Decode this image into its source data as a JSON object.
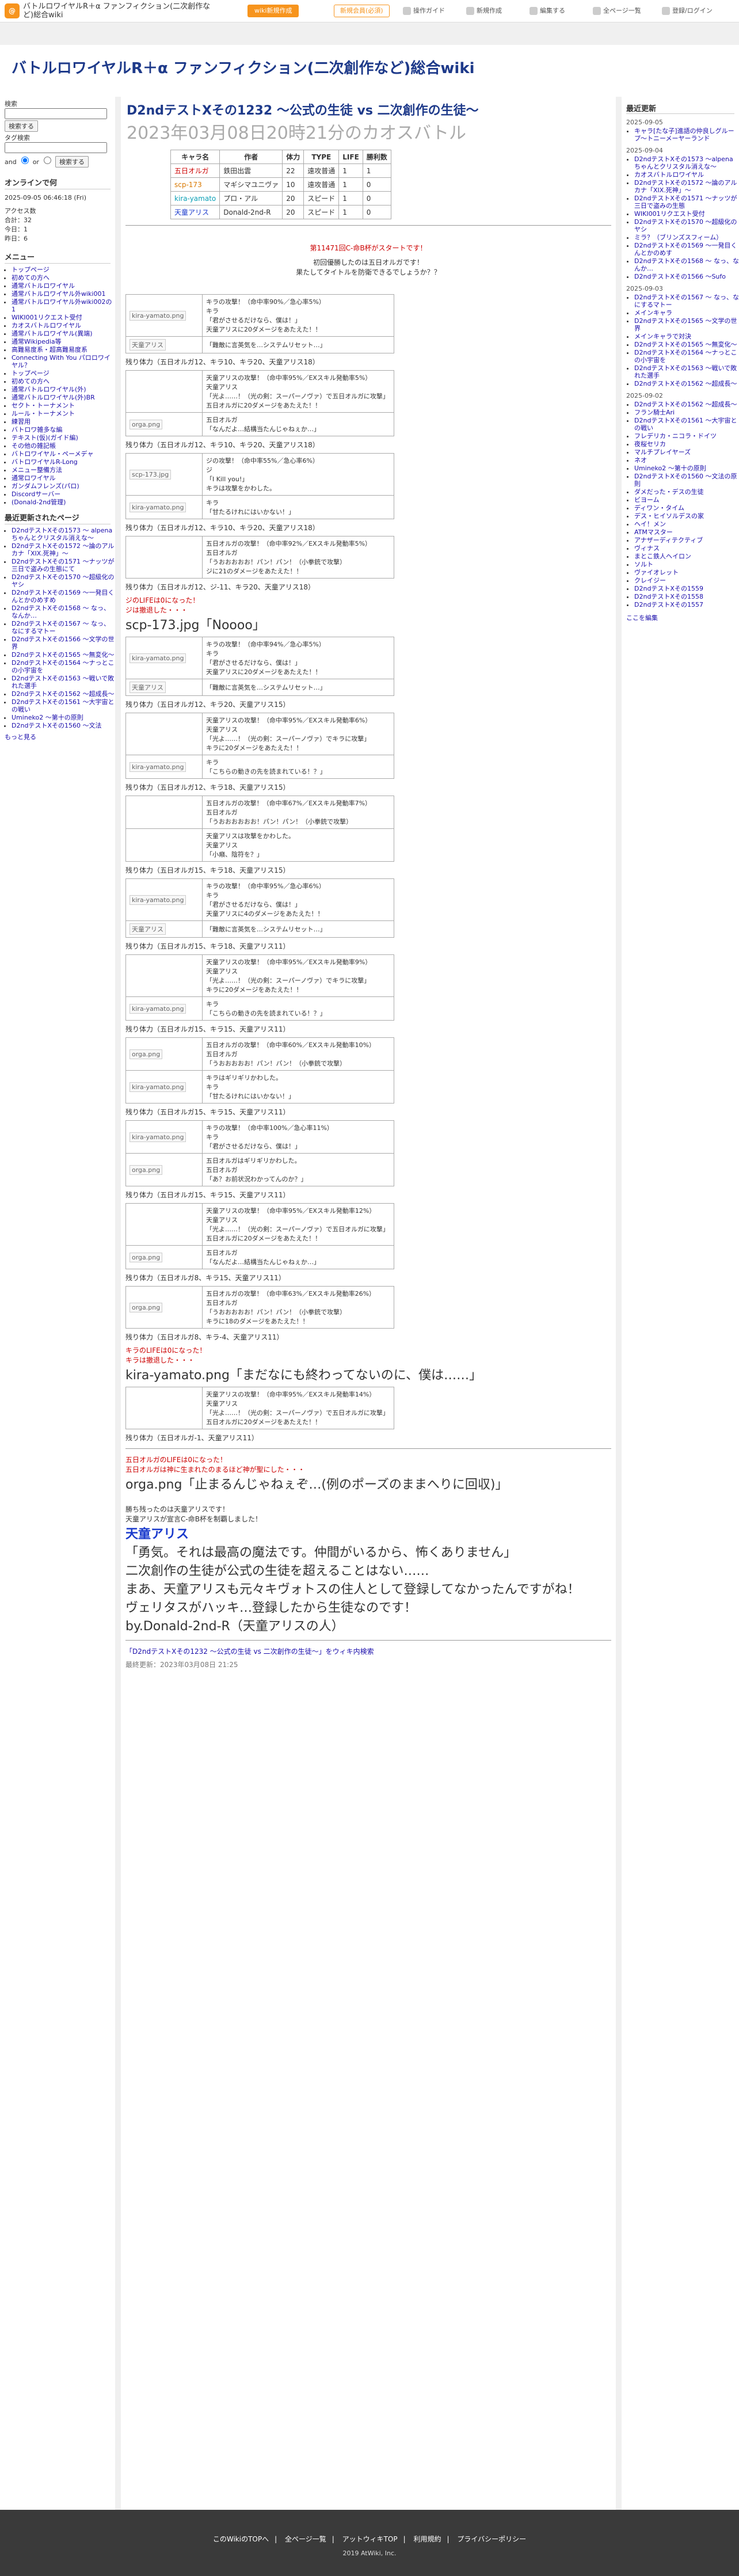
{
  "site": {
    "logo": "@",
    "name": "バトルロワイヤルR＋α ファンフィクション(二次創作など)総合wiki",
    "btn_wiki": "wiki新規作成",
    "btn_login": "新規会員(必須)",
    "nav": [
      "操作ガイド",
      "新規作成",
      "編集する",
      "全ページ一覧",
      "登録/ログイン"
    ]
  },
  "header": {
    "title": "バトルロワイヤルR＋α ファンフィクション(二次創作など)総合wiki"
  },
  "left": {
    "search_label": "検索",
    "search_btn": "検索する",
    "search_placeholder": "",
    "tools_label": "タグ検索",
    "and_label": "and",
    "or_label": "or",
    "search_btn2": "検索する",
    "online_label": "オンラインで何",
    "date": "2025-09-05 06:46:18 (Fri)",
    "stats": [
      "アクセス数",
      "合計：32",
      "今日：1",
      "昨日：6"
    ],
    "menu_title": "メニュー",
    "menu": [
      "トップページ",
      "初めての方へ",
      "通常バトルロワイヤル",
      "通常バトルロワイヤル外wiki001",
      "通常バトルロワイヤル外wiki002の1",
      "WIKI001リクエスト受付",
      "カオスバトルロワイヤル",
      "通常バトルロワイヤル(異端)",
      "通常Wikipedia等",
      "高難易度系・超高難易度系",
      "Connecting With You パロロワイヤル？",
      "トップページ",
      "初めての方へ",
      "通常バトルロワイヤル(外)",
      "通常バトルロワイヤル(外)BR",
      "セクト・トーナメント",
      "ルール・トーナメント",
      "練習用",
      "バトロワ雑多な編",
      "テキスト(仮)(ガイド編)",
      "その他の雑記帳",
      "バトロワイヤル・ペーメデャ",
      "バトロワイヤルR-Long",
      "メニュー整備方法",
      "通常ロワイヤル",
      "ガンダムフレンズ(パロ)",
      "Discordサーバー",
      "(Donald-2nd管理)"
    ],
    "recent_title": "最近更新されたページ",
    "recent": [
      "D2ndテストXその1573 〜 alpenaちゃんとクリスタル消えな〜",
      "D2ndテストXその1572 〜論のアルカナ「XIX.死神」〜",
      "D2ndテストXその1571 〜ナッツが三日で盗みの生態にて",
      "D2ndテストXその1570 〜超級化のヤシ",
      "D2ndテストXその1569 〜一発目くんとかのめすめ",
      "D2ndテストXその1568 〜 なっ、なんか…",
      "D2ndテストXその1567 〜 なっ、なにするマトー",
      "D2ndテストXその1566 〜文学の世界",
      "D2ndテストXその1565 〜無変化〜",
      "D2ndテストXその1564 〜ナっとこの小宇宙を",
      "D2ndテストXその1563 〜戦いで敗れた選手",
      "D2ndテストXその1562 〜超成長〜",
      "D2ndテストXその1561 〜大宇宙との戦い",
      "Umineko2 〜第十の原則",
      "D2ndテストXその1560 〜文法"
    ],
    "more": "もっと見る"
  },
  "main": {
    "h2": "D2ndテストXその1232 〜公式の生徒 vs 二次創作の生徒〜",
    "h3": "2023年03月08日20時21分のカオスバトル",
    "table": {
      "headers": [
        "キャラ名",
        "作者",
        "体力",
        "TYPE",
        "LIFE",
        "勝利数"
      ],
      "rows": [
        [
          "五日オルガ",
          "鉄田出雲",
          "22",
          "遠攻普通",
          "1",
          "1"
        ],
        [
          "scp-173",
          "マギシマユニヴァ",
          "10",
          "遠攻普通",
          "1",
          "0"
        ],
        [
          "kira-yamato",
          "プロ・アル",
          "20",
          "スピード",
          "1",
          "0"
        ],
        [
          "天童アリス",
          "Donald-2nd-R",
          "20",
          "スピード",
          "1",
          "0"
        ]
      ]
    },
    "start": [
      "第11471回C-命B杯がスタートです！",
      "初回優勝したのは五日オルガです！",
      "果たしてタイトルを防衛できるでしょうか？？"
    ],
    "logs": [
      {
        "type": "d",
        "a": "kira-yamato.png",
        "lines": [
          "キラの攻撃！（命中率90%／急心率5%）",
          "キラ",
          "「君がさせるだけなら、僕は！」",
          "天童アリスに20ダメージをあたえた！！"
        ],
        "b": "天童アリス",
        "blines": [
          "「難敵に言英気を…システムリセット…」"
        ]
      },
      {
        "type": "s",
        "text": "残り体力（五日オルガ12、キラ10、キラ20、天童アリス18）"
      },
      {
        "type": "d",
        "a": "",
        "lines": [
          "天童アリスの攻撃！（命中率95%／EXスキル発動率5%）",
          "天童アリス",
          "「光よ……！（光の剣：スーパーノヴァ）で五日オルガに攻撃」",
          "五日オルガに20ダメージをあたえた！！"
        ],
        "b": "orga.png",
        "blines": [
          "五日オルガ",
          "「なんだよ…結構当たんじゃねぇか…」"
        ]
      },
      {
        "type": "s",
        "text": "残り体力（五日オルガ12、キラ10、キラ20、天童アリス18）"
      },
      {
        "type": "d",
        "a": "scp-173.jpg",
        "lines": [
          "ジの攻撃！（命中率55%／急心率6%）",
          "ジ",
          "「I Kill you!」",
          "キラは攻撃をかわした。"
        ],
        "b": "kira-yamato.png",
        "blines": [
          "キラ",
          "「甘たるけれにはいかない！」"
        ]
      },
      {
        "type": "s",
        "text": "残り体力（五日オルガ12、キラ10、キラ20、天童アリス18）"
      },
      {
        "type": "d",
        "a": "",
        "lines": [
          "五日オルガの攻撃！（命中率92%／EXスキル発動率5%）",
          "五日オルガ",
          "「うおおおおお！パン！パン！（小拳銃で攻撃）",
          "ジに21のダメージをあたえた！！"
        ],
        "b": "",
        "blines": []
      },
      {
        "type": "s",
        "text": "残り体力（五日オルガ12、ジ-11、キラ20、天童アリス18）"
      },
      {
        "type": "f",
        "l1": "ジのLIFEは0になった！",
        "l2": "ジは撤退した・・・",
        "img": "scp-173.jpg「Noooo」"
      },
      {
        "type": "d",
        "a": "kira-yamato.png",
        "lines": [
          "キラの攻撃！（命中率94%／急心率5%）",
          "キラ",
          "「君がさせるだけなら、僕は！」",
          "天童アリスに20ダメージをあたえた！！"
        ],
        "b": "天童アリス",
        "blines": [
          "「難敵に言英気を…システムリセット…」"
        ]
      },
      {
        "type": "s",
        "text": "残り体力（五日オルガ12、キラ20、天童アリス15）"
      },
      {
        "type": "d",
        "a": "",
        "lines": [
          "天童アリスの攻撃！（命中率95%／EXスキル発動率6%）",
          "天童アリス",
          "「光よ……！（光の剣：スーパーノヴァ）でキラに攻撃」",
          "キラに20ダメージをあたえた！！"
        ],
        "b": "kira-yamato.png",
        "blines": [
          "キラ",
          "「こちらの動きの先を読まれている！？」"
        ]
      },
      {
        "type": "s",
        "text": "残り体力（五日オルガ12、キラ18、天童アリス15）"
      },
      {
        "type": "d",
        "a": "",
        "lines": [
          "五日オルガの攻撃！（命中率67%／EXスキル発動率7%）",
          "五日オルガ",
          "「うおおおおおお！パン！パン！（小拳銃で攻撃）"
        ],
        "b": "",
        "blines": [
          "天童アリスは攻撃をかわした。",
          "天童アリス",
          "「小癪、陰符を？」"
        ]
      },
      {
        "type": "s",
        "text": "残り体力（五日オルガ15、キラ18、天童アリス15）"
      },
      {
        "type": "d",
        "a": "kira-yamato.png",
        "lines": [
          "キラの攻撃！（命中率95%／急心率6%）",
          "キラ",
          "「君がさせるだけなら、僕は！」",
          "天童アリスに4のダメージをあたえた！！"
        ],
        "b": "天童アリス",
        "blines": [
          "「難敵に言英気を…システムリセット…」"
        ]
      },
      {
        "type": "s",
        "text": "残り体力（五日オルガ15、キラ18、天童アリス11）"
      },
      {
        "type": "d",
        "a": "",
        "lines": [
          "天童アリスの攻撃！（命中率95%／EXスキル発動率9%）",
          "天童アリス",
          "「光よ……！（光の剣：スーパーノヴァ）でキラに攻撃」",
          "キラに20ダメージをあたえた！！"
        ],
        "b": "kira-yamato.png",
        "blines": [
          "キラ",
          "「こちらの動きの先を読まれている！？」"
        ]
      },
      {
        "type": "s",
        "text": "残り体力（五日オルガ15、キラ15、天童アリス11）"
      },
      {
        "type": "d",
        "a": "orga.png",
        "lines": [
          "五日オルガの攻撃！（命中率60%／EXスキル発動率10%）",
          "五日オルガ",
          "「うおおおおお！パン！パン！（小拳銃で攻撃）"
        ],
        "b": "kira-yamato.png",
        "blines": [
          "キラはギリギリかわした。",
          "キラ",
          "「甘たるけれにはいかない！」"
        ]
      },
      {
        "type": "s",
        "text": "残り体力（五日オルガ15、キラ15、天童アリス11）"
      },
      {
        "type": "d",
        "a": "kira-yamato.png",
        "lines": [
          "キラの攻撃！（命中率100%／急心率11%）",
          "キラ",
          "「君がさせるだけなら、僕は！」"
        ],
        "b": "orga.png",
        "blines": [
          "五日オルガはギリギリかわした。",
          "五日オルガ",
          "「あ？お前状況わかってんのか？」"
        ]
      },
      {
        "type": "s",
        "text": "残り体力（五日オルガ15、キラ15、天童アリス11）"
      },
      {
        "type": "d",
        "a": "",
        "lines": [
          "天童アリスの攻撃！（命中率95%／EXスキル発動率12%）",
          "天童アリス",
          "「光よ……！（光の剣：スーパーノヴァ）で五日オルガに攻撃」",
          "五日オルガに20ダメージをあたえた！！"
        ],
        "b": "orga.png",
        "blines": [
          "五日オルガ",
          "「なんだよ…結構当たんじゃねぇか…」"
        ]
      },
      {
        "type": "s",
        "text": "残り体力（五日オルガ8、キラ15、天童アリス11）"
      },
      {
        "type": "d",
        "a": "orga.png",
        "lines": [
          "五日オルガの攻撃！（命中率63%／EXスキル発動率26%）",
          "五日オルガ",
          "「うおおおおお！パン！パン！（小拳銃で攻撃）",
          "キラに18のダメージをあたえた！！"
        ],
        "b": "",
        "blines": []
      },
      {
        "type": "s",
        "text": "残り体力（五日オルガ8、キラ-4、天童アリス11）"
      },
      {
        "type": "f",
        "l1": "キラのLIFEは0になった！",
        "l2": "キラは撤退した・・・",
        "img": "kira-yamato.png「まだなにも終わってないのに、僕は……」"
      },
      {
        "type": "d",
        "a": "",
        "lines": [
          "天童アリスの攻撃！（命中率95%／EXスキル発動率14%）",
          "天童アリス",
          "「光よ……！（光の剣：スーパーノヴァ）で五日オルガに攻撃」",
          "五日オルガに20ダメージをあたえた！！"
        ],
        "b": "",
        "blines": []
      },
      {
        "type": "s",
        "text": "残り体力（五日オルガ-1、天童アリス11）"
      }
    ],
    "end": {
      "l1": "五日オルガのLIFEは0になった！",
      "l2": "五日オルガは神に生まれたのまるほど神が聖にした・・・",
      "img": "orga.png「止まるんじゃねぇぞ…(例のポーズのままへりに回収)」",
      "w1": "勝ち残ったのは天童アリスです！",
      "w2": "天童アリスが宣言C-命B杯を制覇しました！",
      "w3": "天童アリス",
      "w4": "「勇気。それは最高の魔法です。仲間がいるから、怖くありません」",
      "w5": "二次創作の生徒が公式の生徒を超えることはない……",
      "w6": "まあ、天童アリスも元々キヴォトスの住人として登録してなかったんですがね！",
      "w7": "ヴェリタスがハッキ…登録したから生徒なのです！",
      "w8": "by.Donald-2nd-R（天童アリスの人）"
    },
    "cat": "「D2ndテストXその1232 〜公式の生徒 vs 二次創作の生徒〜」をウィキ内検索",
    "updated": "最終更新：2023年03月08日 21:25"
  },
  "right": {
    "title": "最近更新",
    "groups": [
      {
        "date": "2025-09-05",
        "items": [
          "キャラ[たな子]進語の仲良しグループ〜トニーメーヤーランド"
        ]
      },
      {
        "date": "2025-09-04",
        "items": [
          "D2ndテストXその1573 〜alpenaちゃんとクリスタル消えな〜",
          "カオスバトルロワイヤル",
          "D2ndテストXその1572 〜論のアルカナ「XIX.死神」〜",
          "D2ndテストXその1571 〜ナッツが三日で盗みの生態",
          "WIKI001リクエスト受付",
          "D2ndテストXその1570 〜超級化のヤシ",
          "ミラ？（ブリンズスフィーム）",
          "D2ndテストXその1569 〜一発目くんとかのめす",
          "D2ndテストXその1568 〜 なっ、なんか…",
          "D2ndテストXその1566 〜Sufo"
        ]
      },
      {
        "date": "2025-09-03",
        "items": [
          "D2ndテストXその1567 〜 なっ、なにするマトー",
          "メインキャラ",
          "D2ndテストXその1565 〜文学の世界",
          "メインキャラで対決",
          "D2ndテストXその1565 〜無変化〜",
          "D2ndテストXその1564 〜ナっとこの小宇宙を",
          "D2ndテストXその1563 〜戦いで敗れた選手",
          "D2ndテストXその1562 〜超成長〜"
        ]
      },
      {
        "date": "2025-09-02",
        "items": [
          "D2ndテストXその1562 〜超成長〜",
          "フラン騎士Ari",
          "D2ndテストXその1561 〜大宇宙との戦い",
          "フレデリカ・ニコラ・ドイツ",
          "夜桜セリカ",
          "マルチプレイヤーズ",
          "ネオ",
          "Umineko2 〜第十の原則",
          "D2ndテストXその1560 〜文法の原則",
          "ダメだった・デスの生徒",
          "ビヨーム",
          "ディワン・タイム",
          "デス・ヒイソルデスの家",
          "ヘイ！メン",
          "ATMマスター",
          "アナザーディテクティブ",
          "ヴィナス",
          "まとこ鉄人ヘイロン",
          "ソルト",
          "ヴァイオレット",
          "クレイジー",
          "D2ndテストXその1559",
          "D2ndテストXその1558",
          "D2ndテストXその1557"
        ]
      }
    ],
    "here": "ここを編集"
  },
  "footer": {
    "links": [
      "このWikiのTOPへ",
      "全ページ一覧",
      "アットウィキTOP",
      "利用規約",
      "プライバシーポリシー"
    ],
    "copy": "2019 AtWiki, Inc."
  }
}
